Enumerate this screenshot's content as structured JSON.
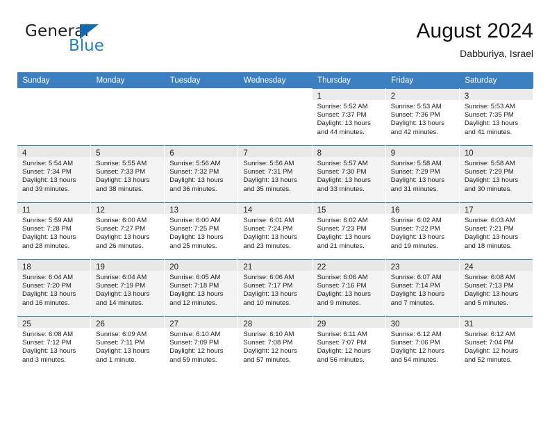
{
  "brand": {
    "name_top": "General",
    "name_bottom": "Blue",
    "triangle_color": "#1268b3",
    "blue_color": "#1f7fd0"
  },
  "header": {
    "title": "August 2024",
    "subtitle": "Dabburiya, Israel"
  },
  "theme": {
    "header_bg": "#3c7fc1",
    "header_text": "#ffffff",
    "row_alt_bg": "#f4f4f4",
    "day_number_bg": "#ebebeb"
  },
  "calendar": {
    "weekday_headers": [
      "Sunday",
      "Monday",
      "Tuesday",
      "Wednesday",
      "Thursday",
      "Friday",
      "Saturday"
    ],
    "weeks": [
      [
        {
          "empty": true
        },
        {
          "empty": true
        },
        {
          "empty": true
        },
        {
          "empty": true
        },
        {
          "day": "1",
          "sunrise": "Sunrise: 5:52 AM",
          "sunset": "Sunset: 7:37 PM",
          "daylight1": "Daylight: 13 hours",
          "daylight2": "and 44 minutes."
        },
        {
          "day": "2",
          "sunrise": "Sunrise: 5:53 AM",
          "sunset": "Sunset: 7:36 PM",
          "daylight1": "Daylight: 13 hours",
          "daylight2": "and 42 minutes."
        },
        {
          "day": "3",
          "sunrise": "Sunrise: 5:53 AM",
          "sunset": "Sunset: 7:35 PM",
          "daylight1": "Daylight: 13 hours",
          "daylight2": "and 41 minutes."
        }
      ],
      [
        {
          "day": "4",
          "sunrise": "Sunrise: 5:54 AM",
          "sunset": "Sunset: 7:34 PM",
          "daylight1": "Daylight: 13 hours",
          "daylight2": "and 39 minutes."
        },
        {
          "day": "5",
          "sunrise": "Sunrise: 5:55 AM",
          "sunset": "Sunset: 7:33 PM",
          "daylight1": "Daylight: 13 hours",
          "daylight2": "and 38 minutes."
        },
        {
          "day": "6",
          "sunrise": "Sunrise: 5:56 AM",
          "sunset": "Sunset: 7:32 PM",
          "daylight1": "Daylight: 13 hours",
          "daylight2": "and 36 minutes."
        },
        {
          "day": "7",
          "sunrise": "Sunrise: 5:56 AM",
          "sunset": "Sunset: 7:31 PM",
          "daylight1": "Daylight: 13 hours",
          "daylight2": "and 35 minutes."
        },
        {
          "day": "8",
          "sunrise": "Sunrise: 5:57 AM",
          "sunset": "Sunset: 7:30 PM",
          "daylight1": "Daylight: 13 hours",
          "daylight2": "and 33 minutes."
        },
        {
          "day": "9",
          "sunrise": "Sunrise: 5:58 AM",
          "sunset": "Sunset: 7:29 PM",
          "daylight1": "Daylight: 13 hours",
          "daylight2": "and 31 minutes."
        },
        {
          "day": "10",
          "sunrise": "Sunrise: 5:58 AM",
          "sunset": "Sunset: 7:29 PM",
          "daylight1": "Daylight: 13 hours",
          "daylight2": "and 30 minutes."
        }
      ],
      [
        {
          "day": "11",
          "sunrise": "Sunrise: 5:59 AM",
          "sunset": "Sunset: 7:28 PM",
          "daylight1": "Daylight: 13 hours",
          "daylight2": "and 28 minutes."
        },
        {
          "day": "12",
          "sunrise": "Sunrise: 6:00 AM",
          "sunset": "Sunset: 7:27 PM",
          "daylight1": "Daylight: 13 hours",
          "daylight2": "and 26 minutes."
        },
        {
          "day": "13",
          "sunrise": "Sunrise: 6:00 AM",
          "sunset": "Sunset: 7:25 PM",
          "daylight1": "Daylight: 13 hours",
          "daylight2": "and 25 minutes."
        },
        {
          "day": "14",
          "sunrise": "Sunrise: 6:01 AM",
          "sunset": "Sunset: 7:24 PM",
          "daylight1": "Daylight: 13 hours",
          "daylight2": "and 23 minutes."
        },
        {
          "day": "15",
          "sunrise": "Sunrise: 6:02 AM",
          "sunset": "Sunset: 7:23 PM",
          "daylight1": "Daylight: 13 hours",
          "daylight2": "and 21 minutes."
        },
        {
          "day": "16",
          "sunrise": "Sunrise: 6:02 AM",
          "sunset": "Sunset: 7:22 PM",
          "daylight1": "Daylight: 13 hours",
          "daylight2": "and 19 minutes."
        },
        {
          "day": "17",
          "sunrise": "Sunrise: 6:03 AM",
          "sunset": "Sunset: 7:21 PM",
          "daylight1": "Daylight: 13 hours",
          "daylight2": "and 18 minutes."
        }
      ],
      [
        {
          "day": "18",
          "sunrise": "Sunrise: 6:04 AM",
          "sunset": "Sunset: 7:20 PM",
          "daylight1": "Daylight: 13 hours",
          "daylight2": "and 16 minutes."
        },
        {
          "day": "19",
          "sunrise": "Sunrise: 6:04 AM",
          "sunset": "Sunset: 7:19 PM",
          "daylight1": "Daylight: 13 hours",
          "daylight2": "and 14 minutes."
        },
        {
          "day": "20",
          "sunrise": "Sunrise: 6:05 AM",
          "sunset": "Sunset: 7:18 PM",
          "daylight1": "Daylight: 13 hours",
          "daylight2": "and 12 minutes."
        },
        {
          "day": "21",
          "sunrise": "Sunrise: 6:06 AM",
          "sunset": "Sunset: 7:17 PM",
          "daylight1": "Daylight: 13 hours",
          "daylight2": "and 10 minutes."
        },
        {
          "day": "22",
          "sunrise": "Sunrise: 6:06 AM",
          "sunset": "Sunset: 7:16 PM",
          "daylight1": "Daylight: 13 hours",
          "daylight2": "and 9 minutes."
        },
        {
          "day": "23",
          "sunrise": "Sunrise: 6:07 AM",
          "sunset": "Sunset: 7:14 PM",
          "daylight1": "Daylight: 13 hours",
          "daylight2": "and 7 minutes."
        },
        {
          "day": "24",
          "sunrise": "Sunrise: 6:08 AM",
          "sunset": "Sunset: 7:13 PM",
          "daylight1": "Daylight: 13 hours",
          "daylight2": "and 5 minutes."
        }
      ],
      [
        {
          "day": "25",
          "sunrise": "Sunrise: 6:08 AM",
          "sunset": "Sunset: 7:12 PM",
          "daylight1": "Daylight: 13 hours",
          "daylight2": "and 3 minutes."
        },
        {
          "day": "26",
          "sunrise": "Sunrise: 6:09 AM",
          "sunset": "Sunset: 7:11 PM",
          "daylight1": "Daylight: 13 hours",
          "daylight2": "and 1 minute."
        },
        {
          "day": "27",
          "sunrise": "Sunrise: 6:10 AM",
          "sunset": "Sunset: 7:09 PM",
          "daylight1": "Daylight: 12 hours",
          "daylight2": "and 59 minutes."
        },
        {
          "day": "28",
          "sunrise": "Sunrise: 6:10 AM",
          "sunset": "Sunset: 7:08 PM",
          "daylight1": "Daylight: 12 hours",
          "daylight2": "and 57 minutes."
        },
        {
          "day": "29",
          "sunrise": "Sunrise: 6:11 AM",
          "sunset": "Sunset: 7:07 PM",
          "daylight1": "Daylight: 12 hours",
          "daylight2": "and 56 minutes."
        },
        {
          "day": "30",
          "sunrise": "Sunrise: 6:12 AM",
          "sunset": "Sunset: 7:06 PM",
          "daylight1": "Daylight: 12 hours",
          "daylight2": "and 54 minutes."
        },
        {
          "day": "31",
          "sunrise": "Sunrise: 6:12 AM",
          "sunset": "Sunset: 7:04 PM",
          "daylight1": "Daylight: 12 hours",
          "daylight2": "and 52 minutes."
        }
      ]
    ]
  }
}
